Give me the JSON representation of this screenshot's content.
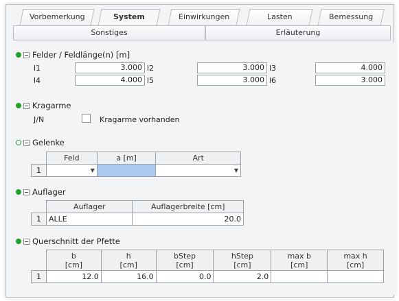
{
  "tabs": [
    {
      "label": "Vorbemerkung",
      "active": false
    },
    {
      "label": "System",
      "active": true
    },
    {
      "label": "Einwirkungen",
      "active": false
    },
    {
      "label": "Lasten",
      "active": false
    },
    {
      "label": "Bemessung",
      "active": false
    }
  ],
  "subtabs": [
    "Sonstiges",
    "Erläuterung"
  ],
  "felder": {
    "title": "Felder / Feldlänge(n) [m]",
    "fields": [
      {
        "label": "l1",
        "value": "3.000"
      },
      {
        "label": "l2",
        "value": "3.000"
      },
      {
        "label": "l3",
        "value": "4.000"
      },
      {
        "label": "l4",
        "value": "4.000"
      },
      {
        "label": "l5",
        "value": "3.000"
      },
      {
        "label": "l6",
        "value": "3.000"
      }
    ]
  },
  "kragarme": {
    "title": "Kragarme",
    "jn_label": "J/N",
    "checkbox_label": "Kragarme vorhanden",
    "checked": false
  },
  "gelenke": {
    "title": "Gelenke",
    "columns": [
      "Feld",
      "a [m]",
      "Art"
    ],
    "rows": [
      {
        "no": "1",
        "feld": "",
        "a": "",
        "art": ""
      }
    ]
  },
  "auflager": {
    "title": "Auflager",
    "columns": [
      "Auflager",
      "Auflagerbreite [cm]"
    ],
    "rows": [
      {
        "no": "1",
        "auflager": "ALLE",
        "breite": "20.0"
      }
    ]
  },
  "querschnitt": {
    "title": "Querschnitt der Pfette",
    "columns": [
      {
        "name": "b",
        "unit": "[cm]"
      },
      {
        "name": "h",
        "unit": "[cm]"
      },
      {
        "name": "bStep",
        "unit": "[cm]"
      },
      {
        "name": "hStep",
        "unit": "[cm]"
      },
      {
        "name": "max b",
        "unit": "[cm]"
      },
      {
        "name": "max h",
        "unit": "[cm]"
      }
    ],
    "rows": [
      {
        "no": "1",
        "values": [
          "12.0",
          "16.0",
          "0.0",
          "2.0",
          "",
          ""
        ]
      }
    ]
  },
  "colors": {
    "status_green": "#1fa12a",
    "selected_cell": "#a9c9ee"
  }
}
